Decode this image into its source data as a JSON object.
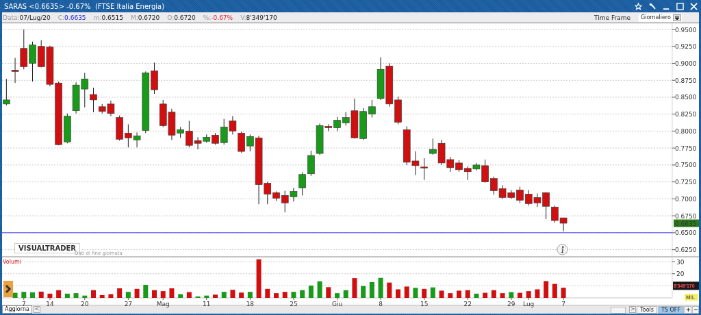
{
  "window": {
    "title": "SARAS <0.6635> -0.67%  (FTSE Italia Energia)"
  },
  "quote_bar": {
    "fields": [
      {
        "label": "Data:",
        "value": "07/Lug/20",
        "kind": "plain"
      },
      {
        "label": "C:",
        "value": "0.6635",
        "kind": "close"
      },
      {
        "label": "m:",
        "value": "0.6515",
        "kind": "plain"
      },
      {
        "label": "M:",
        "value": "0.6720",
        "kind": "plain"
      },
      {
        "label": "O:",
        "value": "0.6720",
        "kind": "plain"
      },
      {
        "label": "%:",
        "value": "-0.67%",
        "kind": "change"
      },
      {
        "label": "V:",
        "value": "8'349'170",
        "kind": "plain"
      }
    ],
    "time_frame_label": "Time Frame",
    "time_frame_value": "Giornaliero"
  },
  "price_panel": {
    "logo": "VISUALTRADER",
    "caption": "Dati di fine giornata",
    "last_price_tag": "0.6635",
    "chart_data": {
      "type": "candlestick",
      "grid": true,
      "categories": [
        null,
        null,
        null,
        null,
        null,
        null,
        null,
        null,
        null,
        null,
        null,
        null,
        null,
        null,
        null,
        null,
        null,
        null,
        null,
        null,
        null,
        null,
        null,
        null,
        null,
        null,
        null,
        null,
        null,
        null,
        null,
        null,
        null,
        null,
        null,
        null,
        null,
        null,
        null,
        null,
        null,
        null,
        null,
        null,
        null,
        null,
        null,
        null,
        null,
        null,
        null,
        null,
        null,
        null,
        null,
        null,
        null,
        null,
        null,
        null,
        null,
        null,
        null,
        null,
        null,
        null,
        null,
        null,
        null,
        null,
        null,
        null,
        null,
        null,
        null,
        null,
        null
      ],
      "ohlc": [
        [
          0.84,
          0.877,
          0.838,
          0.846
        ],
        [
          0.89,
          0.908,
          0.871,
          0.888
        ],
        [
          0.922,
          0.95,
          0.891,
          0.895
        ],
        [
          0.9,
          0.932,
          0.873,
          0.927
        ],
        [
          0.925,
          0.934,
          0.894,
          0.895
        ],
        [
          0.924,
          0.926,
          0.866,
          0.869
        ],
        [
          0.871,
          0.873,
          0.779,
          0.78
        ],
        [
          0.784,
          0.826,
          0.782,
          0.822
        ],
        [
          0.83,
          0.872,
          0.826,
          0.868
        ],
        [
          0.862,
          0.886,
          0.835,
          0.877
        ],
        [
          0.854,
          0.864,
          0.828,
          0.846
        ],
        [
          0.836,
          0.84,
          0.826,
          0.829
        ],
        [
          0.84,
          0.845,
          0.822,
          0.826
        ],
        [
          0.82,
          0.823,
          0.786,
          0.788
        ],
        [
          0.797,
          0.81,
          0.776,
          0.79
        ],
        [
          0.787,
          0.798,
          0.776,
          0.793
        ],
        [
          0.801,
          0.888,
          0.797,
          0.886
        ],
        [
          0.889,
          0.901,
          0.855,
          0.861
        ],
        [
          0.84,
          0.846,
          0.806,
          0.808
        ],
        [
          0.828,
          0.833,
          0.787,
          0.794
        ],
        [
          0.797,
          0.806,
          0.79,
          0.802
        ],
        [
          0.8,
          0.815,
          0.776,
          0.779
        ],
        [
          0.786,
          0.791,
          0.773,
          0.782
        ],
        [
          0.785,
          0.795,
          0.783,
          0.791
        ],
        [
          0.794,
          0.797,
          0.78,
          0.782
        ],
        [
          0.783,
          0.818,
          0.78,
          0.806
        ],
        [
          0.815,
          0.822,
          0.795,
          0.8
        ],
        [
          0.797,
          0.799,
          0.768,
          0.77
        ],
        [
          0.778,
          0.795,
          0.77,
          0.792
        ],
        [
          0.79,
          0.793,
          0.692,
          0.721
        ],
        [
          0.723,
          0.725,
          0.692,
          0.707
        ],
        [
          0.709,
          0.711,
          0.697,
          0.701
        ],
        [
          0.705,
          0.712,
          0.68,
          0.694
        ],
        [
          0.703,
          0.716,
          0.696,
          0.711
        ],
        [
          0.716,
          0.739,
          0.705,
          0.736
        ],
        [
          0.737,
          0.771,
          0.734,
          0.764
        ],
        [
          0.767,
          0.811,
          0.765,
          0.808
        ],
        [
          0.807,
          0.81,
          0.8,
          0.805
        ],
        [
          0.805,
          0.821,
          0.8,
          0.816
        ],
        [
          0.812,
          0.828,
          0.808,
          0.82
        ],
        [
          0.83,
          0.848,
          0.789,
          0.79
        ],
        [
          0.789,
          0.834,
          0.787,
          0.829
        ],
        [
          0.825,
          0.846,
          0.82,
          0.836
        ],
        [
          0.848,
          0.909,
          0.846,
          0.891
        ],
        [
          0.896,
          0.9,
          0.836,
          0.84
        ],
        [
          0.846,
          0.851,
          0.81,
          0.813
        ],
        [
          0.802,
          0.807,
          0.75,
          0.754
        ],
        [
          0.756,
          0.77,
          0.735,
          0.749
        ],
        [
          0.747,
          0.76,
          0.728,
          0.746
        ],
        [
          0.767,
          0.789,
          0.765,
          0.773
        ],
        [
          0.782,
          0.787,
          0.75,
          0.753
        ],
        [
          0.758,
          0.762,
          0.74,
          0.746
        ],
        [
          0.753,
          0.757,
          0.74,
          0.743
        ],
        [
          0.745,
          0.748,
          0.728,
          0.74
        ],
        [
          0.744,
          0.753,
          0.742,
          0.75
        ],
        [
          0.749,
          0.758,
          0.724,
          0.725
        ],
        [
          0.73,
          0.733,
          0.706,
          0.712
        ],
        [
          0.715,
          0.72,
          0.7,
          0.702
        ],
        [
          0.709,
          0.713,
          0.7,
          0.702
        ],
        [
          0.713,
          0.718,
          0.694,
          0.698
        ],
        [
          0.707,
          0.713,
          0.69,
          0.693
        ],
        [
          0.702,
          0.708,
          0.688,
          0.694
        ],
        [
          0.709,
          0.71,
          0.67,
          0.689
        ],
        [
          0.688,
          0.69,
          0.665,
          0.668
        ],
        [
          0.672,
          0.672,
          0.652,
          0.664
        ],
        null,
        null,
        null,
        null,
        null,
        null,
        null,
        null,
        null,
        null,
        null,
        null
      ],
      "ref_lines": [
        {
          "axis": "y",
          "value": 0.65,
          "color": "#3a3aff"
        }
      ],
      "ylim": [
        0.6155,
        0.9591
      ],
      "yticks": [
        {
          "value": 0.625,
          "label": "0.6250"
        },
        {
          "value": 0.65,
          "label": "0.6500"
        },
        {
          "value": 0.675,
          "label": "0.6750"
        },
        {
          "value": 0.7,
          "label": "0.7000"
        },
        {
          "value": 0.725,
          "label": "0.7250"
        },
        {
          "value": 0.75,
          "label": "0.7500"
        },
        {
          "value": 0.775,
          "label": "0.7750"
        },
        {
          "value": 0.8,
          "label": "0.8000"
        },
        {
          "value": 0.825,
          "label": "0.8250"
        },
        {
          "value": 0.85,
          "label": "0.8500"
        },
        {
          "value": 0.875,
          "label": "0.8750"
        },
        {
          "value": 0.9,
          "label": "0.9000"
        },
        {
          "value": 0.925,
          "label": "0.9250"
        },
        {
          "value": 0.95,
          "label": "0.9500"
        }
      ]
    }
  },
  "volume_panel": {
    "last_value": "8'349'170",
    "unit": "MIL",
    "chart_data": {
      "type": "bar",
      "title": "Volumi",
      "stacked": true,
      "grid": true,
      "categories": [
        null,
        null,
        "7",
        null,
        null,
        "14",
        null,
        null,
        null,
        "20",
        null,
        null,
        null,
        null,
        "27",
        null,
        null,
        null,
        "Mag",
        null,
        null,
        null,
        null,
        "11",
        null,
        null,
        null,
        null,
        "18",
        null,
        null,
        null,
        null,
        "25",
        null,
        null,
        null,
        null,
        "Giu",
        null,
        null,
        null,
        null,
        "8",
        null,
        null,
        null,
        null,
        "15",
        null,
        null,
        null,
        null,
        "22",
        null,
        null,
        null,
        null,
        "29",
        null,
        "Lug",
        null,
        null,
        null,
        "7",
        null,
        null,
        null,
        null,
        null,
        null,
        null,
        null,
        null,
        null,
        null,
        null
      ],
      "series": [
        {
          "color": "#1a9a1a",
          "values": [
            null,
            4.2,
            5.0,
            4.6,
            null,
            null,
            null,
            3.5,
            3.9,
            1.9,
            null,
            null,
            null,
            null,
            5.0,
            null,
            10.8,
            null,
            null,
            null,
            3.1,
            null,
            1.2,
            1.9,
            null,
            5.0,
            null,
            null,
            5.0,
            null,
            null,
            null,
            null,
            5.0,
            6.4,
            10.2,
            13.7,
            null,
            3.9,
            6.4,
            null,
            9.8,
            13.1,
            16.6,
            null,
            null,
            null,
            8.3,
            null,
            8.7,
            null,
            null,
            null,
            null,
            3.5,
            null,
            null,
            null,
            4.8,
            null,
            null,
            null,
            null,
            null,
            null,
            null,
            null,
            null,
            null,
            null,
            null,
            null,
            null,
            null,
            null,
            null,
            null
          ]
        },
        {
          "color": "#d01010",
          "values": [
            null,
            null,
            null,
            null,
            5.2,
            3.5,
            6.4,
            null,
            null,
            null,
            6.4,
            2.3,
            3.1,
            7.9,
            null,
            7.5,
            null,
            6.4,
            5.6,
            7.9,
            null,
            4.8,
            null,
            null,
            2.7,
            null,
            6.7,
            4.4,
            null,
            32,
            7.5,
            3.9,
            5.0,
            null,
            null,
            null,
            null,
            8.9,
            null,
            null,
            16.4,
            null,
            null,
            null,
            12.7,
            7.1,
            9.4,
            null,
            7.5,
            null,
            6.0,
            3.9,
            6.0,
            6.4,
            null,
            4.2,
            6.4,
            3.9,
            null,
            4.2,
            5.6,
            7.1,
            13.9,
            11.6,
            8.4,
            null,
            null,
            null,
            null,
            null,
            null,
            null,
            null,
            null,
            null,
            null,
            null
          ]
        }
      ],
      "ylim": [
        0,
        33.5
      ],
      "yticks": [
        {
          "value": 20,
          "label": "20"
        },
        {
          "value": 30,
          "label": "30"
        }
      ]
    }
  },
  "bottom_bar": {
    "tab": "Aggiorna",
    "scroll_left": "<",
    "scroll_right": ">",
    "buttons": [
      {
        "label": "Tools",
        "selected": false
      },
      {
        "label": "TS OFF",
        "selected": true
      },
      {
        "label": "+",
        "selected": false
      },
      {
        "label": "−",
        "selected": false
      }
    ]
  }
}
